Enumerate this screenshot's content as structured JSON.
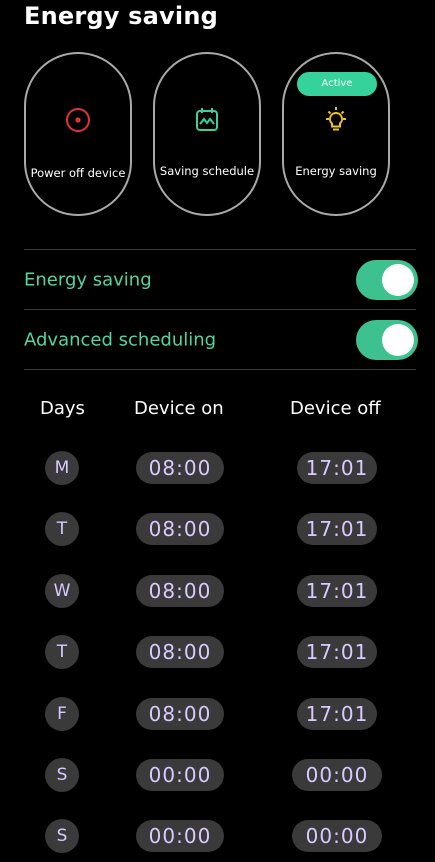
{
  "header": {
    "title": "Energy saving"
  },
  "cards": [
    {
      "label": "Power off device",
      "icon": "power-target-icon",
      "active": false
    },
    {
      "label": "Saving schedule",
      "icon": "calendar-wave-icon",
      "active": false
    },
    {
      "label": "Energy saving",
      "icon": "lightbulb-icon",
      "active": true,
      "badge": "Active"
    }
  ],
  "toggles": [
    {
      "label": "Energy saving",
      "on": true
    },
    {
      "label": "Advanced scheduling",
      "on": true
    }
  ],
  "schedule": {
    "headers": {
      "days": "Days",
      "on": "Device on",
      "off": "Device off"
    },
    "rows": [
      {
        "day": "M",
        "on": "08:00",
        "off": "17:01"
      },
      {
        "day": "T",
        "on": "08:00",
        "off": "17:01"
      },
      {
        "day": "W",
        "on": "08:00",
        "off": "17:01"
      },
      {
        "day": "T",
        "on": "08:00",
        "off": "17:01"
      },
      {
        "day": "F",
        "on": "08:00",
        "off": "17:01"
      },
      {
        "day": "S",
        "on": "00:00",
        "off": "00:00"
      },
      {
        "day": "S",
        "on": "00:00",
        "off": "00:00"
      }
    ]
  },
  "colors": {
    "accent": "#35d39b",
    "toggle": "#3cc18f",
    "label_green": "#52d6a0",
    "time_text": "#d8c9ff",
    "pill_bg": "#3a3a3a",
    "power_icon": "#e0343a",
    "bulb_icon": "#f2c21b"
  }
}
